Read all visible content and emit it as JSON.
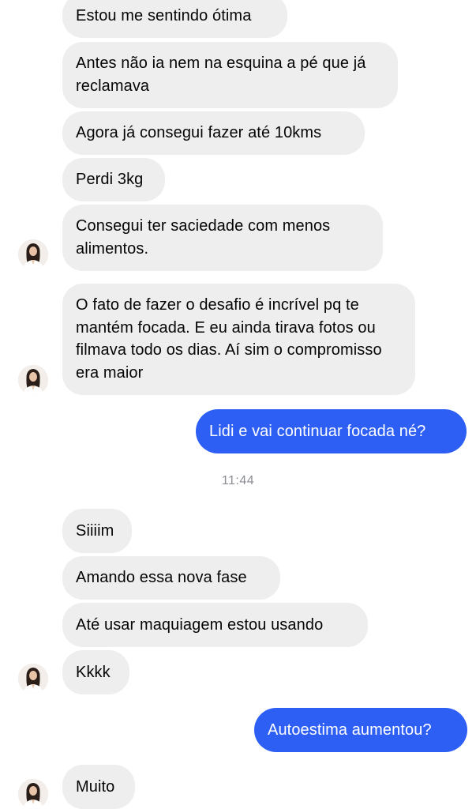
{
  "conversation": {
    "messages": [
      {
        "text": "Estou me sentindo ótima"
      },
      {
        "text": "Antes não ia nem na esquina a pé que já reclamava"
      },
      {
        "text": "Agora já consegui fazer até 10kms"
      },
      {
        "text": "Perdi 3kg"
      },
      {
        "text": "Consegui ter saciedade com menos alimentos."
      },
      {
        "text": "O fato de fazer o desafio é incrível pq te mantém focada. E eu ainda tirava fotos ou filmava todo os dias. Aí sim o compromisso era maior"
      },
      {
        "text": "Lidi e vai continuar focada né?"
      },
      {
        "text": "Siiiim"
      },
      {
        "text": "Amando essa nova fase"
      },
      {
        "text": "Até usar maquiagem estou usando"
      },
      {
        "text": "Kkkk"
      },
      {
        "text": "Autoestima aumentou?"
      },
      {
        "text": "Muito"
      }
    ],
    "timestamp": "11:44"
  },
  "colors": {
    "incoming_bubble": "#eeeeef",
    "outgoing_bubble": "#2e5ff5",
    "timestamp_text": "#8a8d91"
  }
}
